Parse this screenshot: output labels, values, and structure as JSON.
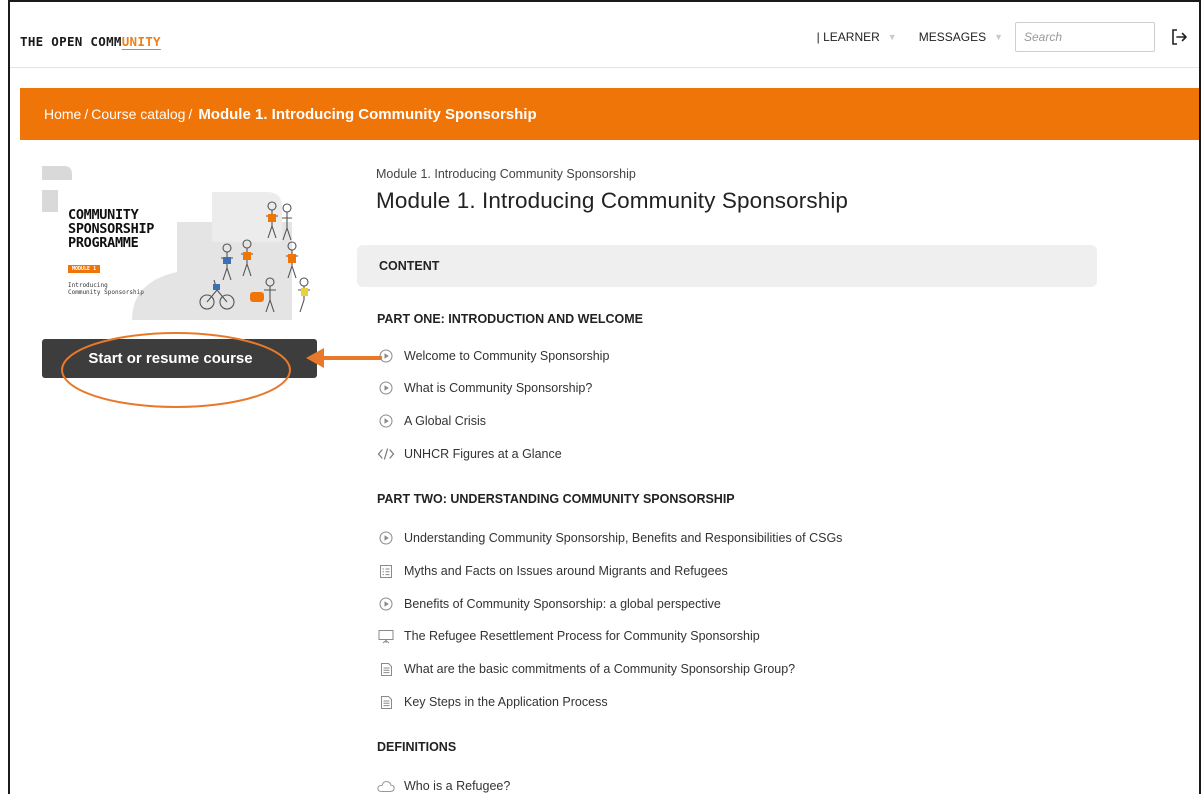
{
  "header": {
    "logo_prefix": "THE OPEN COMM",
    "logo_accent": "UNITY",
    "nav": {
      "learner": "| LEARNER",
      "messages": "MESSAGES"
    },
    "search_placeholder": "Search",
    "logout_icon": "logout-icon"
  },
  "breadcrumb": {
    "home": "Home",
    "catalog": "Course catalog",
    "separator": "/",
    "current": "Module 1. Introducing Community Sponsorship"
  },
  "cover": {
    "title_lines": [
      "COMMUNITY",
      "SPONSORSHIP",
      "PROGRAMME"
    ],
    "tag": "MODULE 1",
    "subtitle_lines": [
      "Introducing",
      "Community Sponsorship"
    ]
  },
  "start_button": "Start or resume course",
  "module": {
    "subtitle": "Module 1. Introducing Community Sponsorship",
    "title": "Module 1. Introducing Community Sponsorship"
  },
  "content_label": "CONTENT",
  "sections": [
    {
      "heading": "PART ONE: INTRODUCTION AND WELCOME",
      "items": [
        {
          "label": "Welcome to Community Sponsorship",
          "icon": "play-icon"
        },
        {
          "label": "What is Community Sponsorship?",
          "icon": "play-icon"
        },
        {
          "label": "A Global Crisis",
          "icon": "play-icon"
        },
        {
          "label": "UNHCR Figures at a Glance",
          "icon": "code-icon"
        }
      ]
    },
    {
      "heading": "PART TWO: UNDERSTANDING COMMUNITY SPONSORSHIP",
      "items": [
        {
          "label": "Understanding Community Sponsorship, Benefits and Responsibilities of CSGs",
          "icon": "play-icon"
        },
        {
          "label": "Myths and Facts on Issues around Migrants and Refugees",
          "icon": "quiz-icon"
        },
        {
          "label": "Benefits of Community Sponsorship: a global perspective",
          "icon": "play-icon"
        },
        {
          "label": "The Refugee Resettlement Process for Community Sponsorship",
          "icon": "presentation-icon"
        },
        {
          "label": "What are the basic commitments of a Community Sponsorship Group?",
          "icon": "document-icon"
        },
        {
          "label": "Key Steps in the Application Process",
          "icon": "document-icon"
        }
      ]
    },
    {
      "heading": "DEFINITIONS",
      "items": [
        {
          "label": "Who is a Refugee?",
          "icon": "cloud-icon"
        }
      ]
    }
  ],
  "colors": {
    "brand_orange": "#f07508",
    "button_dark": "#3d3d3d",
    "annotation_orange": "#e8792a"
  }
}
